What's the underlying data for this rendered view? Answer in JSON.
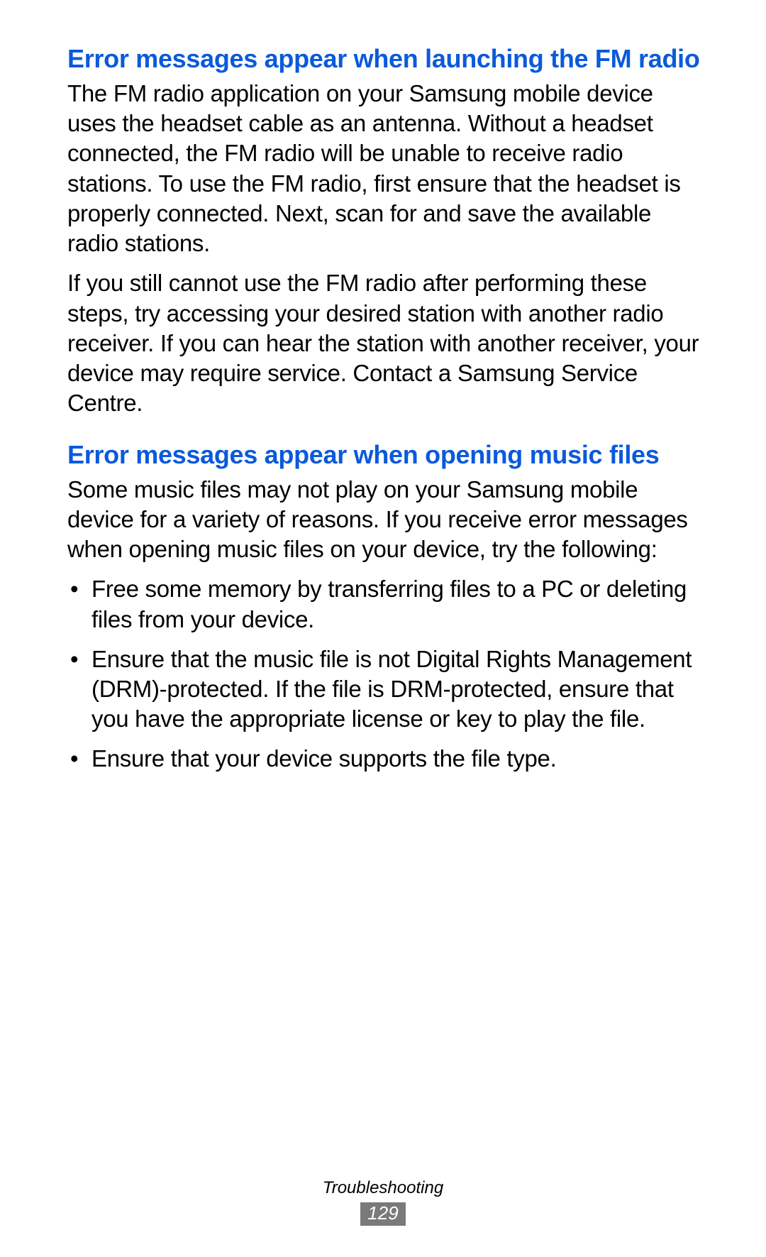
{
  "sections": [
    {
      "heading": "Error messages appear when launching the FM radio",
      "paragraphs": [
        "The FM radio application on your Samsung mobile device uses the headset cable as an antenna. Without a headset connected, the FM radio will be unable to receive radio stations. To use the FM radio, first ensure that the headset is properly connected. Next, scan for and save the available radio stations.",
        "If you still cannot use the FM radio after performing these steps, try accessing your desired station with another radio receiver. If you can hear the station with another receiver, your device may require service. Contact a Samsung Service Centre."
      ]
    },
    {
      "heading": "Error messages appear when opening music files",
      "paragraphs": [
        "Some music files may not play on your Samsung mobile device for a variety of reasons. If you receive error messages when opening music files on your device, try the following:"
      ],
      "bullets": [
        "Free some memory by transferring files to a PC or deleting files from your device.",
        "Ensure that the music file is not Digital Rights Management (DRM)-protected. If the file is DRM-protected, ensure that you have the appropriate license or key to play the file.",
        "Ensure that your device supports the file type."
      ]
    }
  ],
  "footer": {
    "section_label": "Troubleshooting",
    "page_number": "129"
  }
}
